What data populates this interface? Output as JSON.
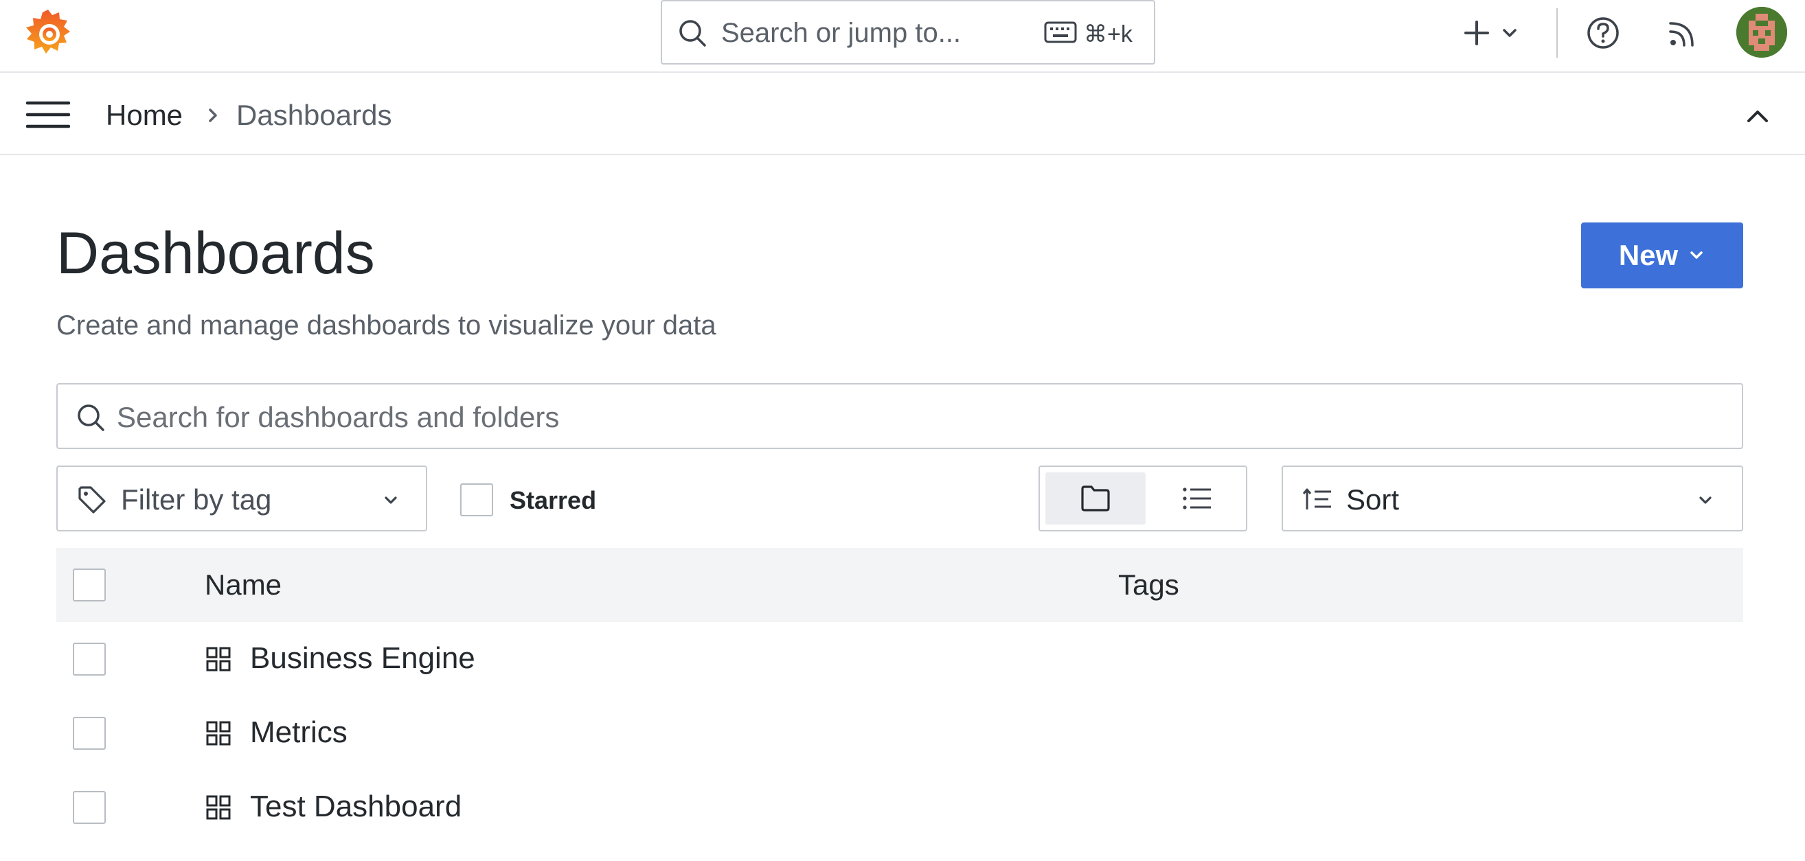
{
  "topbar": {
    "search_placeholder": "Search or jump to...",
    "search_shortcut": "⌘+k"
  },
  "breadcrumb": {
    "home": "Home",
    "current": "Dashboards"
  },
  "page": {
    "title": "Dashboards",
    "subtitle": "Create and manage dashboards to visualize your data",
    "new_button": "New"
  },
  "filters": {
    "search_placeholder": "Search for dashboards and folders",
    "tag_filter": "Filter by tag",
    "starred_label": "Starred",
    "sort_label": "Sort"
  },
  "table": {
    "columns": [
      "Name",
      "Tags"
    ],
    "rows": [
      {
        "name": "Business Engine"
      },
      {
        "name": "Metrics"
      },
      {
        "name": "Test Dashboard"
      }
    ]
  },
  "colors": {
    "primary": "#3d71d9",
    "header_bg": "#f3f4f5",
    "border": "#c7cbd0"
  }
}
